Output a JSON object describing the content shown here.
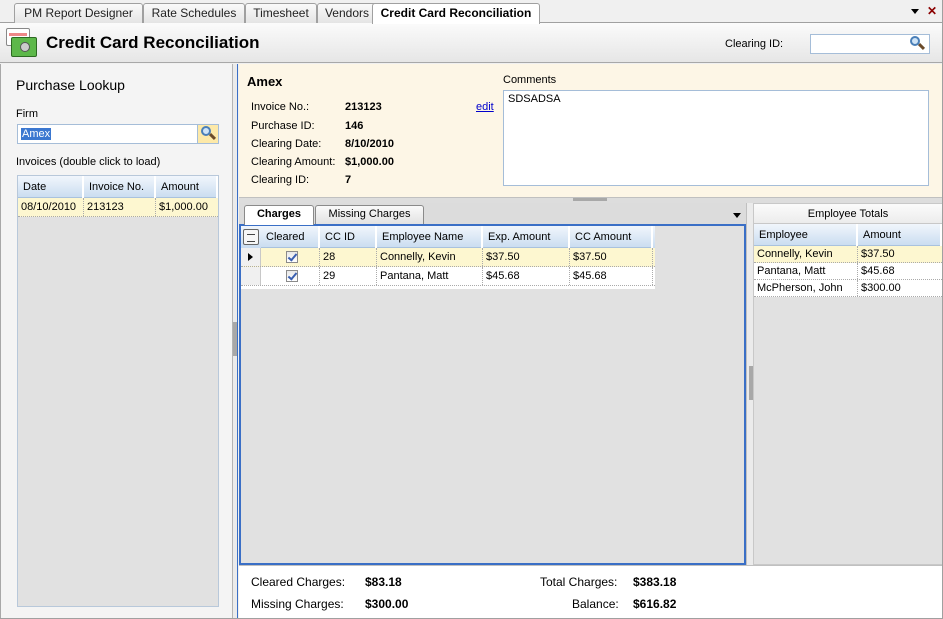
{
  "tabs": [
    {
      "label": "PM Report Designer",
      "active": false
    },
    {
      "label": "Rate Schedules",
      "active": false
    },
    {
      "label": "Timesheet",
      "active": false
    },
    {
      "label": "Vendors",
      "active": false
    },
    {
      "label": "Credit Card Reconciliation",
      "active": true
    }
  ],
  "header": {
    "title": "Credit Card Reconciliation",
    "clearing_id_label": "Clearing ID:",
    "clearing_id_value": ""
  },
  "purchase_lookup": {
    "title": "Purchase Lookup",
    "firm_label": "Firm",
    "firm_value": "Amex",
    "invoices_label": "Invoices (double click to load)",
    "columns": [
      "Date",
      "Invoice No.",
      "Amount"
    ],
    "rows": [
      {
        "date": "08/10/2010",
        "invoice_no": "213123",
        "amount": "$1,000.00"
      }
    ]
  },
  "invoice_info": {
    "firm_name": "Amex",
    "fields": [
      {
        "label": "Invoice No.:",
        "value": "213123"
      },
      {
        "label": "Purchase ID:",
        "value": "146"
      },
      {
        "label": "Clearing Date:",
        "value": "8/10/2010"
      },
      {
        "label": "Clearing Amount:",
        "value": "$1,000.00"
      },
      {
        "label": "Clearing ID:",
        "value": "7"
      }
    ],
    "edit_label": "edit",
    "comments_label": "Comments",
    "comments_value": "SDSADSA"
  },
  "charges": {
    "tabs": [
      {
        "label": "Charges",
        "active": true
      },
      {
        "label": "Missing Charges",
        "active": false
      }
    ],
    "columns": [
      "Cleared",
      "CC ID",
      "Employee Name",
      "Exp. Amount",
      "CC Amount"
    ],
    "rows": [
      {
        "cleared": true,
        "cc_id": "28",
        "employee": "Connelly, Kevin",
        "exp_amount": "$37.50",
        "cc_amount": "$37.50",
        "selected": true
      },
      {
        "cleared": true,
        "cc_id": "29",
        "employee": "Pantana, Matt",
        "exp_amount": "$45.68",
        "cc_amount": "$45.68",
        "selected": false
      }
    ]
  },
  "employee_totals": {
    "title": "Employee Totals",
    "columns": [
      "Employee",
      "Amount"
    ],
    "rows": [
      {
        "employee": "Connelly, Kevin",
        "amount": "$37.50"
      },
      {
        "employee": "Pantana, Matt",
        "amount": "$45.68"
      },
      {
        "employee": "McPherson, John",
        "amount": "$300.00"
      }
    ]
  },
  "totals": {
    "cleared_label": "Cleared Charges:",
    "cleared_value": "$83.18",
    "missing_label": "Missing Charges:",
    "missing_value": "$300.00",
    "total_label": "Total Charges:",
    "total_value": "$383.18",
    "balance_label": "Balance:",
    "balance_value": "$616.82"
  }
}
